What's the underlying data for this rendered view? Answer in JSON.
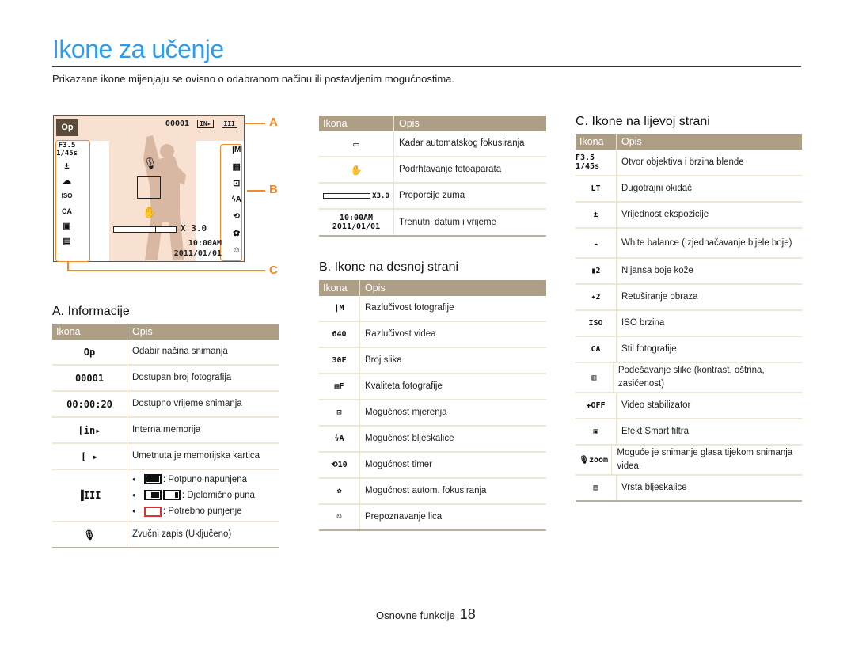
{
  "page": {
    "title": "Ikone za učenje",
    "subtitle": "Prikazane ikone mijenjaju se ovisno o odabranom načinu ili postavljenim mogućnostima.",
    "footer_section": "Osnovne funkcije",
    "page_number": "18"
  },
  "screen": {
    "mode_icon": "Op",
    "photo_count": "00001",
    "memory_icon": "int",
    "battery_icon": "full",
    "left_icons": [
      "F3.5 1/45s",
      "±",
      "☁",
      "ISO",
      "CA",
      "▣",
      "▤"
    ],
    "right_icons": [
      "|M",
      "▦F",
      "⊡",
      "ϟA",
      "⟲10",
      "✿",
      "☺"
    ],
    "zoom_text": "X 3.0",
    "time": "10:00AM",
    "date": "2011/01/01",
    "callouts": [
      "A",
      "B",
      "C"
    ]
  },
  "table_headers": {
    "icon": "Ikona",
    "desc": "Opis"
  },
  "section_a": {
    "heading": "A. Informacije",
    "rows": [
      {
        "icon": "Op",
        "icon_name": "camera-mode-icon",
        "desc": "Odabir načina snimanja"
      },
      {
        "icon": "00001",
        "icon_name": "photo-count-icon",
        "desc": "Dostupan broj fotografija"
      },
      {
        "icon": "00:00:20",
        "icon_name": "recording-time-icon",
        "desc": "Dostupno vrijeme snimanja"
      },
      {
        "icon": "[in▸",
        "icon_name": "internal-memory-icon",
        "desc": "Interna memorija"
      },
      {
        "icon": "[ ▸",
        "icon_name": "memory-card-icon",
        "desc": "Umetnuta je memorijska kartica"
      },
      {
        "icon": "▐III",
        "icon_name": "battery-icon",
        "desc": ""
      },
      {
        "icon": "🎙",
        "icon_name": "microphone-icon",
        "desc": "Zvučni zapis (Uključeno)"
      }
    ],
    "battery_states": [
      {
        "label": ": Potpuno napunjena",
        "level": 1.0
      },
      {
        "label": ": Djelomično puna",
        "level": 0.66,
        "level2": 0.33
      },
      {
        "label": ": Potrebno punjenje",
        "level": 0.0
      }
    ]
  },
  "section_top_mid": {
    "rows": [
      {
        "icon": "▭",
        "icon_name": "af-frame-icon",
        "desc": "Kadar automatskog fokusiranja"
      },
      {
        "icon": "✋",
        "icon_name": "camera-shake-icon",
        "desc": "Podrhtavanje fotoaparata"
      },
      {
        "icon": "X3.0",
        "icon_name": "zoom-ratio-icon",
        "desc": "Proporcije zuma"
      },
      {
        "icon": "10:00AM 2011/01/01",
        "icon_name": "date-time-icon",
        "desc": "Trenutni datum i vrijeme"
      }
    ]
  },
  "section_b": {
    "heading": "B. Ikone na desnoj strani",
    "rows": [
      {
        "icon": "|M",
        "icon_name": "photo-resolution-icon",
        "desc": "Razlučivost fotografije"
      },
      {
        "icon": "640",
        "icon_name": "video-resolution-icon",
        "desc": "Razlučivost videa"
      },
      {
        "icon": "30F",
        "icon_name": "frame-rate-icon",
        "desc": "Broj slika"
      },
      {
        "icon": "▦F",
        "icon_name": "photo-quality-icon",
        "desc": "Kvaliteta fotografije"
      },
      {
        "icon": "⊡",
        "icon_name": "metering-icon",
        "desc": "Mogućnost mjerenja"
      },
      {
        "icon": "ϟA",
        "icon_name": "flash-icon",
        "desc": "Mogućnost bljeskalice"
      },
      {
        "icon": "⟲10",
        "icon_name": "timer-icon",
        "desc": "Mogućnost timer"
      },
      {
        "icon": "✿",
        "icon_name": "macro-focus-icon",
        "desc": "Mogućnost autom. fokusiranja"
      },
      {
        "icon": "☺",
        "icon_name": "face-detection-icon",
        "desc": "Prepoznavanje lica"
      }
    ]
  },
  "section_c": {
    "heading": "C. Ikone na lijevoj strani",
    "rows": [
      {
        "icon": "F3.5 1/45s",
        "icon_name": "aperture-shutter-icon",
        "desc": "Otvor objektiva i brzina blende"
      },
      {
        "icon": "LT",
        "icon_name": "long-time-shutter-icon",
        "desc": "Dugotrajni okidač"
      },
      {
        "icon": "±",
        "icon_name": "exposure-icon",
        "desc": "Vrijednost ekspozicije"
      },
      {
        "icon": "☁",
        "icon_name": "white-balance-icon",
        "desc": "White balance (Izjednačavanje bijele boje)"
      },
      {
        "icon": "▮2",
        "icon_name": "skin-tone-icon",
        "desc": "Nijansa boje kože"
      },
      {
        "icon": "✦2",
        "icon_name": "face-retouch-icon",
        "desc": "Retuširanje obraza"
      },
      {
        "icon": "ISO",
        "icon_name": "iso-icon",
        "desc": "ISO brzina"
      },
      {
        "icon": "CA",
        "icon_name": "photo-style-icon",
        "desc": "Stil fotografije"
      },
      {
        "icon": "▥",
        "icon_name": "image-adjust-icon",
        "desc": "Podešavanje slike (kontrast, oštrina, zasićenost)"
      },
      {
        "icon": "✚OFF",
        "icon_name": "video-stabilizer-icon",
        "desc": "Video stabilizator"
      },
      {
        "icon": "▣",
        "icon_name": "smart-filter-icon",
        "desc": "Efekt Smart filtra"
      },
      {
        "icon": "🎙zoom",
        "icon_name": "voice-zoom-icon",
        "desc": "Moguće je snimanje glasa tijekom snimanja videa."
      },
      {
        "icon": "▤",
        "icon_name": "flash-type-icon",
        "desc": "Vrsta bljeskalice"
      }
    ]
  },
  "colors": {
    "title": "#2d9cf0",
    "table_header": "#ad9f86",
    "callout": "#f08a2a",
    "screen_bg": "#f9e1d2",
    "battery_low": "#e23030"
  }
}
